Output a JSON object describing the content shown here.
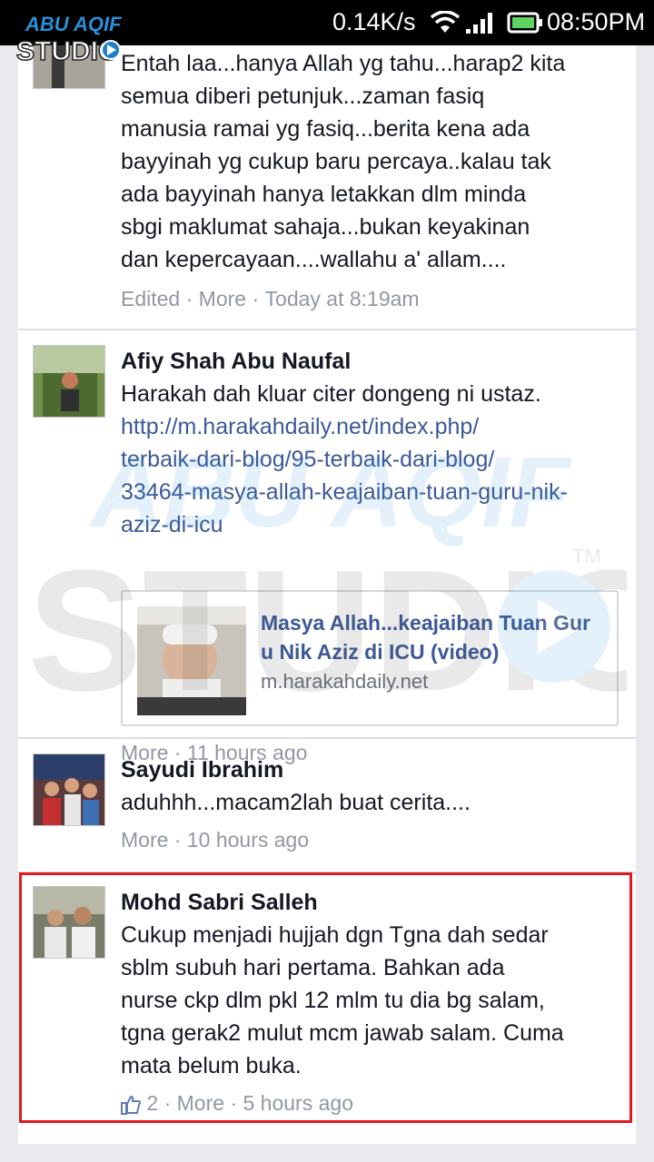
{
  "status_bar": {
    "speed": "0.14K/s",
    "time": "08:50PM"
  },
  "watermark": {
    "top_text": "ABU AQIF",
    "bottom_text": "STUDIO",
    "tm": "TM"
  },
  "comments": [
    {
      "lines": [
        "Entah laa...hanya Allah yg tahu...harap2 kita",
        "semua diberi petunjuk...zaman fasiq",
        "manusia ramai yg fasiq...berita kena ada",
        "bayyinah yg cukup baru percaya..kalau tak",
        "ada bayyinah hanya letakkan dlm minda",
        "sbgi maklumat sahaja...bukan keyakinan",
        "dan kepercayaan....wallahu a' allam...."
      ],
      "meta_edited": "Edited",
      "meta_more": "More",
      "meta_time": "Today at 8:19am"
    },
    {
      "name": "Afiy Shah Abu Naufal",
      "text": "Harakah dah kluar citer dongeng ni ustaz.",
      "link_lines": [
        "http://m.harakahdaily.net/index.php/",
        "terbaik-dari-blog/95-terbaik-dari-blog/",
        "33464-masya-allah-keajaiban-tuan-guru-nik-",
        "aziz-di-icu"
      ],
      "preview_title_lines": [
        "Masya Allah...keajaiban Tuan Gur",
        "u Nik Aziz di ICU (video)"
      ],
      "preview_domain": "m.harakahdaily.net",
      "meta_more": "More",
      "meta_time": "11 hours ago"
    },
    {
      "name": "Sayudi Ibrahim",
      "text": "aduhhh...macam2lah buat cerita....",
      "meta_more": "More",
      "meta_time": "10 hours ago"
    },
    {
      "name": "Mohd Sabri Salleh",
      "lines": [
        "Cukup menjadi hujjah dgn Tgna dah sedar",
        "sblm subuh hari pertama. Bahkan ada",
        "nurse ckp dlm pkl 12 mlm tu dia bg salam,",
        "tgna gerak2 mulut mcm jawab salam. Cuma",
        "mata belum buka."
      ],
      "likes": "2",
      "meta_more": "More",
      "meta_time": "5 hours ago"
    }
  ],
  "colors": {
    "link": "#3b5998",
    "meta": "#9197a3",
    "highlight": "#e0191f"
  }
}
